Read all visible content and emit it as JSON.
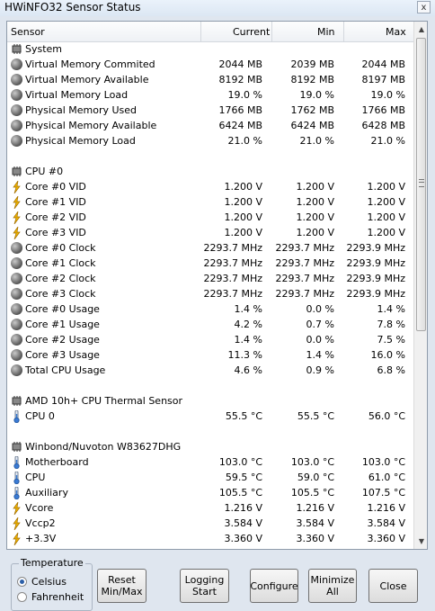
{
  "window": {
    "title": "HWiNFO32 Sensor Status",
    "close_glyph": "x"
  },
  "columns": [
    "Sensor",
    "Current",
    "Min",
    "Max"
  ],
  "rows": [
    {
      "t": "g",
      "icon": "sensor-chip-icon",
      "n": "System"
    },
    {
      "t": "r",
      "icon": "bulb",
      "n": "Virtual Memory Commited",
      "c": "2044 MB",
      "mn": "2039 MB",
      "mx": "2044 MB"
    },
    {
      "t": "r",
      "icon": "bulb",
      "n": "Virtual Memory Available",
      "c": "8192 MB",
      "mn": "8192 MB",
      "mx": "8197 MB"
    },
    {
      "t": "r",
      "icon": "bulb",
      "n": "Virtual Memory Load",
      "c": "19.0 %",
      "mn": "19.0 %",
      "mx": "19.0 %"
    },
    {
      "t": "r",
      "icon": "bulb",
      "n": "Physical Memory Used",
      "c": "1766 MB",
      "mn": "1762 MB",
      "mx": "1766 MB"
    },
    {
      "t": "r",
      "icon": "bulb",
      "n": "Physical Memory Available",
      "c": "6424 MB",
      "mn": "6424 MB",
      "mx": "6428 MB"
    },
    {
      "t": "r",
      "icon": "bulb",
      "n": "Physical Memory Load",
      "c": "21.0 %",
      "mn": "21.0 %",
      "mx": "21.0 %"
    },
    {
      "t": "b"
    },
    {
      "t": "g",
      "icon": "sensor-chip-icon",
      "n": "CPU #0"
    },
    {
      "t": "r",
      "icon": "bolt",
      "n": "Core #0 VID",
      "c": "1.200 V",
      "mn": "1.200 V",
      "mx": "1.200 V"
    },
    {
      "t": "r",
      "icon": "bolt",
      "n": "Core #1 VID",
      "c": "1.200 V",
      "mn": "1.200 V",
      "mx": "1.200 V"
    },
    {
      "t": "r",
      "icon": "bolt",
      "n": "Core #2 VID",
      "c": "1.200 V",
      "mn": "1.200 V",
      "mx": "1.200 V"
    },
    {
      "t": "r",
      "icon": "bolt",
      "n": "Core #3 VID",
      "c": "1.200 V",
      "mn": "1.200 V",
      "mx": "1.200 V"
    },
    {
      "t": "r",
      "icon": "bulb",
      "n": "Core #0 Clock",
      "c": "2293.7 MHz",
      "mn": "2293.7 MHz",
      "mx": "2293.9 MHz"
    },
    {
      "t": "r",
      "icon": "bulb",
      "n": "Core #1 Clock",
      "c": "2293.7 MHz",
      "mn": "2293.7 MHz",
      "mx": "2293.9 MHz"
    },
    {
      "t": "r",
      "icon": "bulb",
      "n": "Core #2 Clock",
      "c": "2293.7 MHz",
      "mn": "2293.7 MHz",
      "mx": "2293.9 MHz"
    },
    {
      "t": "r",
      "icon": "bulb",
      "n": "Core #3 Clock",
      "c": "2293.7 MHz",
      "mn": "2293.7 MHz",
      "mx": "2293.9 MHz"
    },
    {
      "t": "r",
      "icon": "bulb",
      "n": "Core #0 Usage",
      "c": "1.4 %",
      "mn": "0.0 %",
      "mx": "1.4 %"
    },
    {
      "t": "r",
      "icon": "bulb",
      "n": "Core #1 Usage",
      "c": "4.2 %",
      "mn": "0.7 %",
      "mx": "7.8 %"
    },
    {
      "t": "r",
      "icon": "bulb",
      "n": "Core #2 Usage",
      "c": "1.4 %",
      "mn": "0.0 %",
      "mx": "7.5 %"
    },
    {
      "t": "r",
      "icon": "bulb",
      "n": "Core #3 Usage",
      "c": "11.3 %",
      "mn": "1.4 %",
      "mx": "16.0 %"
    },
    {
      "t": "r",
      "icon": "bulb",
      "n": "Total CPU Usage",
      "c": "4.6 %",
      "mn": "0.9 %",
      "mx": "6.8 %"
    },
    {
      "t": "b"
    },
    {
      "t": "g",
      "icon": "sensor-chip-icon",
      "n": "AMD 10h+ CPU Thermal Sensor"
    },
    {
      "t": "r",
      "icon": "therm",
      "n": "CPU 0",
      "c": "55.5 °C",
      "mn": "55.5 °C",
      "mx": "56.0 °C"
    },
    {
      "t": "b"
    },
    {
      "t": "g",
      "icon": "sensor-chip-icon",
      "n": "Winbond/Nuvoton W83627DHG"
    },
    {
      "t": "r",
      "icon": "therm",
      "n": "Motherboard",
      "c": "103.0 °C",
      "mn": "103.0 °C",
      "mx": "103.0 °C"
    },
    {
      "t": "r",
      "icon": "therm",
      "n": "CPU",
      "c": "59.5 °C",
      "mn": "59.0 °C",
      "mx": "61.0 °C"
    },
    {
      "t": "r",
      "icon": "therm",
      "n": "Auxiliary",
      "c": "105.5 °C",
      "mn": "105.5 °C",
      "mx": "107.5 °C"
    },
    {
      "t": "r",
      "icon": "bolt",
      "n": "Vcore",
      "c": "1.216 V",
      "mn": "1.216 V",
      "mx": "1.216 V"
    },
    {
      "t": "r",
      "icon": "bolt",
      "n": "Vccp2",
      "c": "3.584 V",
      "mn": "3.584 V",
      "mx": "3.584 V"
    },
    {
      "t": "r",
      "icon": "bolt",
      "n": "+3.3V",
      "c": "3.360 V",
      "mn": "3.360 V",
      "mx": "3.360 V"
    }
  ],
  "temperature": {
    "legend": "Temperature",
    "celsius": "Celsius",
    "fahrenheit": "Fahrenheit",
    "selected": "Celsius"
  },
  "buttons": {
    "reset": "Reset Min/Max",
    "logging": "Logging Start",
    "configure": "Configure",
    "minimize": "Minimize All",
    "close": "Close"
  },
  "scroll": {
    "up_glyph": "▲",
    "down_glyph": "▼",
    "position": 0.0
  }
}
